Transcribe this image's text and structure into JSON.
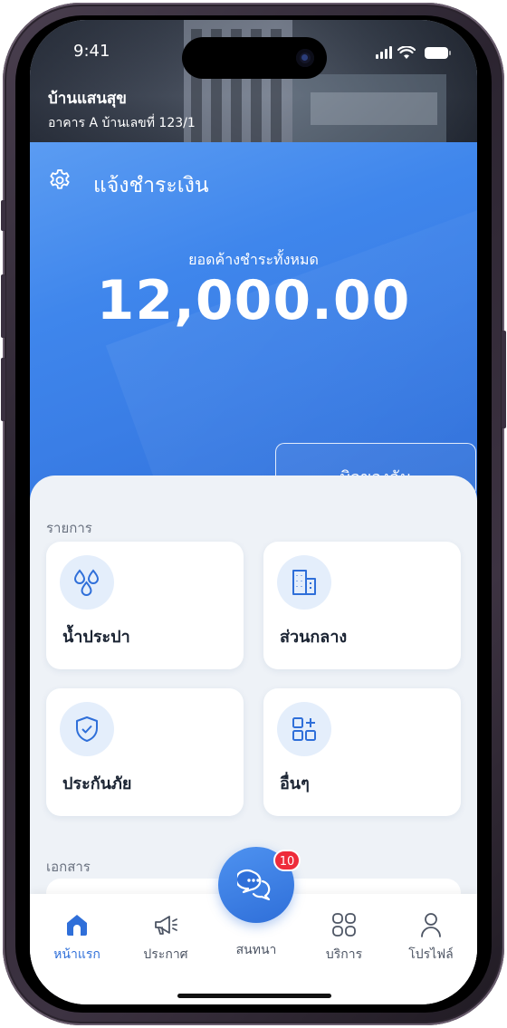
{
  "status_bar": {
    "time": "9:41"
  },
  "header": {
    "project_name": "บ้านแสนสุข",
    "unit_info": "อาคาร A  บ้านเลขที่ 123/1"
  },
  "payment_card": {
    "title": "แจ้งชำระเงิน",
    "outstanding_label": "ยอดค้างชำระทั้งหมด",
    "outstanding_amount": "12,000.00",
    "my_bill_button": "บิลของฉัน",
    "settings_icon": "gear-icon"
  },
  "sections": {
    "items_label": "รายการ",
    "documents_label": "เอกสาร"
  },
  "tiles": [
    {
      "label": "น้ำประปา",
      "icon": "water-drops-icon"
    },
    {
      "label": "ส่วนกลาง",
      "icon": "building-icon"
    },
    {
      "label": "ประกันภัย",
      "icon": "shield-check-icon"
    },
    {
      "label": "อื่นๆ",
      "icon": "grid-plus-icon"
    }
  ],
  "bottom_nav": {
    "items": [
      {
        "label": "หน้าแรก",
        "icon": "home-icon",
        "active": true
      },
      {
        "label": "ประกาศ",
        "icon": "megaphone-icon",
        "active": false
      },
      {
        "label": "สนทนา",
        "icon": "chat-icon",
        "active": false
      },
      {
        "label": "บริการ",
        "icon": "grid-icon",
        "active": false
      },
      {
        "label": "โปรไฟล์",
        "icon": "user-icon",
        "active": false
      }
    ],
    "chat_badge_count": "10"
  },
  "colors": {
    "primary": "#3a7ee6",
    "badge": "#ee2b3a",
    "text": "#1b2433"
  }
}
